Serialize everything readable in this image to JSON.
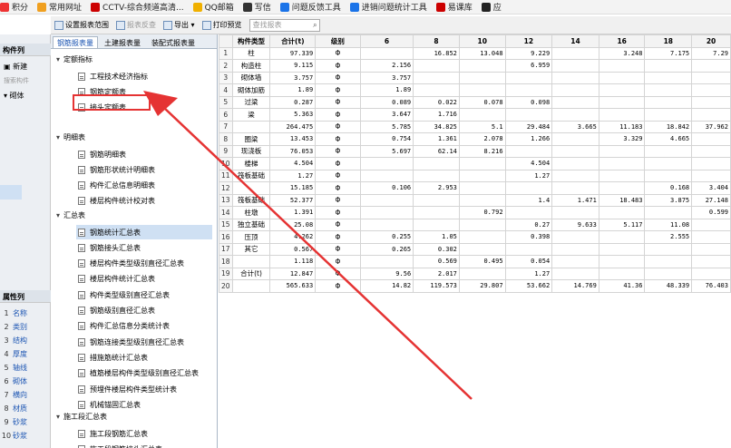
{
  "bookmarks": [
    {
      "label": "积分",
      "color": "#e33"
    },
    {
      "label": "常用网址",
      "color": "#f0a020"
    },
    {
      "label": "CCTV-综合频道高清...",
      "color": "#c00"
    },
    {
      "label": "QQ邮箱",
      "color": "#f0b000"
    },
    {
      "label": "写信",
      "color": "#333"
    },
    {
      "label": "问题反馈工具",
      "color": "#1a73e8"
    },
    {
      "label": "进销问题统计工具",
      "color": "#1a73e8"
    },
    {
      "label": "易课库",
      "color": "#c00"
    },
    {
      "label": "应",
      "color": "#222"
    }
  ],
  "toolbar": {
    "set_range": "设置报表范围",
    "reverse": "报表反查",
    "export": "导出",
    "print_preview": "打印预览",
    "search_placeholder": "查找报表"
  },
  "left": {
    "hd1": "构件列",
    "new_label": "新建",
    "search_label": "搜索构件",
    "tree_item": "砌体",
    "hd2": "属性列",
    "rows": [
      {
        "n": "1",
        "t": "名称"
      },
      {
        "n": "2",
        "t": "类别"
      },
      {
        "n": "3",
        "t": "结构"
      },
      {
        "n": "4",
        "t": "厚度"
      },
      {
        "n": "5",
        "t": "轴线"
      },
      {
        "n": "6",
        "t": "砌体"
      },
      {
        "n": "7",
        "t": "横向"
      },
      {
        "n": "8",
        "t": "材质"
      },
      {
        "n": "9",
        "t": "砂浆"
      },
      {
        "n": "10",
        "t": "砂浆"
      }
    ]
  },
  "tabs": [
    "钢筋报表量",
    "土建报表量",
    "装配式报表量"
  ],
  "tree": {
    "groups": [
      "定额指标",
      "明细表",
      "汇总表",
      "施工段汇总表"
    ],
    "g1": [
      "工程技术经济指标",
      "钢筋定额表",
      "接头定额表"
    ],
    "g2": [
      "钢筋明细表",
      "钢筋形状统计明细表",
      "构件汇总信息明细表",
      "楼层构件统计校对表"
    ],
    "g3": [
      "钢筋统计汇总表",
      "钢筋接头汇总表",
      "楼层构件类型级别直径汇总表",
      "楼层构件统计汇总表",
      "构件类型级别直径汇总表",
      "钢筋级别直径汇总表",
      "构件汇总信息分类统计表",
      "钢筋连接类型级别直径汇总表",
      "措施筋统计汇总表",
      "植筋楼层构件类型级别直径汇总表",
      "预埋件楼层构件类型统计表",
      "机械锚固汇总表"
    ],
    "g4": [
      "施工段钢筋汇总表",
      "施工段钢筋接头汇总表"
    ]
  },
  "table": {
    "headers": [
      "",
      "构件类型",
      "合计(t)",
      "级别",
      "6",
      "8",
      "10",
      "12",
      "14",
      "16",
      "18",
      "20"
    ],
    "level": "Φ",
    "rows": [
      [
        "1",
        "柱",
        "97.339",
        "Φ",
        "",
        "16.852",
        "13.048",
        "9.229",
        "",
        "3.248",
        "7.175",
        "7.29"
      ],
      [
        "2",
        "构造柱",
        "9.115",
        "Φ",
        "2.156",
        "",
        "",
        "6.959",
        "",
        "",
        "",
        ""
      ],
      [
        "3",
        "砌体墙",
        "3.757",
        "Φ",
        "3.757",
        "",
        "",
        "",
        "",
        "",
        "",
        ""
      ],
      [
        "4",
        "砌体加筋",
        "1.89",
        "Φ",
        "1.89",
        "",
        "",
        "",
        "",
        "",
        "",
        ""
      ],
      [
        "5",
        "过梁",
        "0.287",
        "Φ",
        "0.089",
        "0.022",
        "0.078",
        "0.098",
        "",
        "",
        "",
        ""
      ],
      [
        "6",
        "梁",
        "5.363",
        "Φ",
        "3.647",
        "1.716",
        "",
        "",
        "",
        "",
        "",
        ""
      ],
      [
        "7",
        "",
        "264.475",
        "Φ",
        "5.785",
        "34.825",
        "5.1",
        "29.484",
        "3.665",
        "11.183",
        "18.842",
        "37.962"
      ],
      [
        "8",
        "圈梁",
        "13.453",
        "Φ",
        "0.754",
        "1.361",
        "2.078",
        "1.266",
        "",
        "3.329",
        "4.665",
        ""
      ],
      [
        "9",
        "现浇板",
        "76.053",
        "Φ",
        "5.697",
        "62.14",
        "8.216",
        "",
        "",
        "",
        "",
        ""
      ],
      [
        "10",
        "楼梯",
        "4.504",
        "Φ",
        "",
        "",
        "",
        "4.504",
        "",
        "",
        "",
        ""
      ],
      [
        "11",
        "筏板基础",
        "1.27",
        "Φ",
        "",
        "",
        "",
        "1.27",
        "",
        "",
        "",
        ""
      ],
      [
        "12",
        "",
        "15.185",
        "Φ",
        "0.106",
        "2.953",
        "",
        "",
        "",
        "",
        "0.168",
        "3.404"
      ],
      [
        "13",
        "筏板基础",
        "52.377",
        "Φ",
        "",
        "",
        "",
        "1.4",
        "1.471",
        "18.483",
        "3.875",
        "27.148"
      ],
      [
        "14",
        "柱墩",
        "1.391",
        "Φ",
        "",
        "",
        "0.792",
        "",
        "",
        "",
        "",
        "0.599"
      ],
      [
        "15",
        "独立基础",
        "25.08",
        "Φ",
        "",
        "",
        "",
        "0.27",
        "9.633",
        "5.117",
        "11.08",
        ""
      ],
      [
        "16",
        "压顶",
        "4.262",
        "Φ",
        "0.255",
        "1.05",
        "",
        "0.398",
        "",
        "",
        "2.555",
        ""
      ],
      [
        "17",
        "其它",
        "0.567",
        "Φ",
        "0.265",
        "0.302",
        "",
        "",
        "",
        "",
        "",
        ""
      ],
      [
        "18",
        "",
        "1.118",
        "Φ",
        "",
        "0.569",
        "0.495",
        "0.054",
        "",
        "",
        "",
        ""
      ],
      [
        "19",
        "合计(t)",
        "12.847",
        "Φ",
        "9.56",
        "2.017",
        "",
        "1.27",
        "",
        "",
        "",
        ""
      ],
      [
        "20",
        "",
        "565.633",
        "Φ",
        "14.82",
        "119.573",
        "29.807",
        "53.662",
        "14.769",
        "41.36",
        "48.339",
        "76.403"
      ]
    ]
  }
}
